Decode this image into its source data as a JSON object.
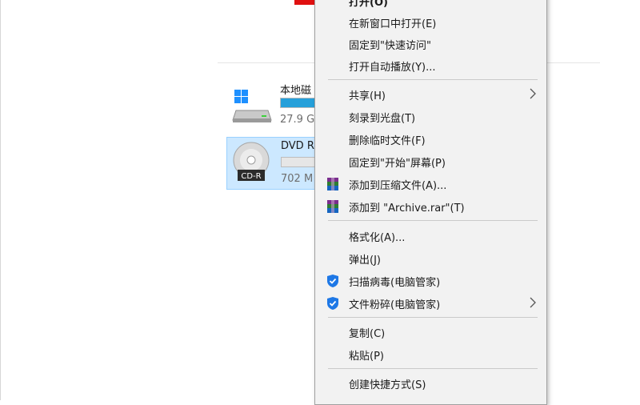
{
  "drives": [
    {
      "name": "本地磁",
      "info": "27.9 G",
      "usage": 0.9,
      "icon": "windows-drive-icon"
    },
    {
      "name": "DVD R",
      "info": "702 M",
      "usage": 0.0,
      "badge": "CD-R",
      "icon": "cd-r-disc-icon"
    }
  ],
  "menu": {
    "open": "打开(O)",
    "open_new_window": "在新窗口中打开(E)",
    "pin_quick_access": "固定到\"快速访问\"",
    "autoplay": "打开自动播放(Y)...",
    "share": "共享(H)",
    "burn": "刻录到光盘(T)",
    "delete_temp": "删除临时文件(F)",
    "pin_start": "固定到\"开始\"屏幕(P)",
    "add_archive": "添加到压缩文件(A)...",
    "add_rar": "添加到 \"Archive.rar\"(T)",
    "format": "格式化(A)...",
    "eject": "弹出(J)",
    "scan_virus": "扫描病毒(电脑管家)",
    "shred": "文件粉碎(电脑管家)",
    "copy": "复制(C)",
    "paste": "粘贴(P)",
    "shortcut": "创建快捷方式(S)"
  },
  "colors": {
    "accent": "#26a0da",
    "selection": "#cce8ff",
    "arrow": "#e01010",
    "shield": "#1e78e6"
  }
}
